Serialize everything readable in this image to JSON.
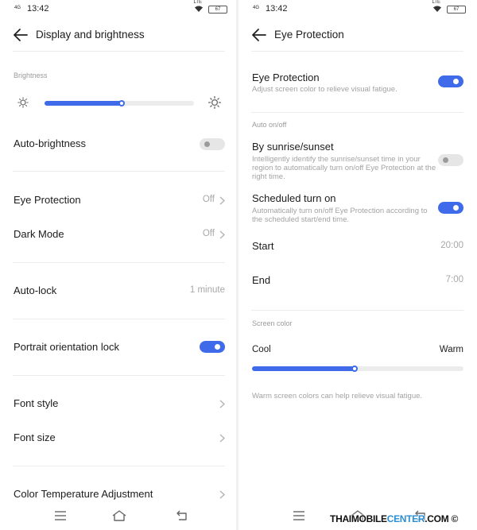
{
  "status_bar": {
    "signal_text": "4G",
    "time": "13:42",
    "lte_text": "LTE",
    "battery": "67"
  },
  "left_screen": {
    "header": {
      "title": "Display and brightness"
    },
    "brightness": {
      "section_label": "Brightness",
      "level": 0.52,
      "low_icon": "sun-small-icon",
      "high_icon": "sun-large-icon"
    },
    "auto_brightness": {
      "label": "Auto-brightness",
      "enabled": false
    },
    "eye_protection": {
      "label": "Eye Protection",
      "value": "Off"
    },
    "dark_mode": {
      "label": "Dark Mode",
      "value": "Off"
    },
    "auto_lock": {
      "label": "Auto-lock",
      "value": "1 minute"
    },
    "portrait_lock": {
      "label": "Portrait orientation lock",
      "enabled": true
    },
    "font_style": {
      "label": "Font style"
    },
    "font_size": {
      "label": "Font size"
    },
    "color_temp": {
      "label": "Color Temperature Adjustment"
    }
  },
  "right_screen": {
    "header": {
      "title": "Eye Protection"
    },
    "eye_protection": {
      "title": "Eye Protection",
      "description": "Adjust screen color to relieve visual fatigue.",
      "enabled": true
    },
    "auto_section_label": "Auto on/off",
    "sunrise_sunset": {
      "title": "By sunrise/sunset",
      "description": "Intelligently identify the sunrise/sunset time in your region to automatically turn on/off Eye Protection at the right time.",
      "enabled": false
    },
    "scheduled": {
      "title": "Scheduled turn on",
      "description": "Automatically turn on/off Eye Protection according to the scheduled start/end time.",
      "enabled": true
    },
    "start": {
      "label": "Start",
      "value": "20:00"
    },
    "end": {
      "label": "End",
      "value": "7:00"
    },
    "screen_color": {
      "section_label": "Screen color",
      "cool_label": "Cool",
      "warm_label": "Warm",
      "level": 0.49,
      "hint": "Warm screen colors can help relieve visual fatigue."
    }
  },
  "navbar": {
    "menu_icon": "menu-icon",
    "home_icon": "home-icon",
    "back_icon": "back-icon"
  },
  "watermark": {
    "main": "THAIMOBILE",
    "accent": "CENTER",
    "suffix": ".COM",
    "mark": "©"
  },
  "colors": {
    "accent": "#3f6bea",
    "toggle_off": "#e6e6e6",
    "secondary_text": "#a3a3a3"
  }
}
